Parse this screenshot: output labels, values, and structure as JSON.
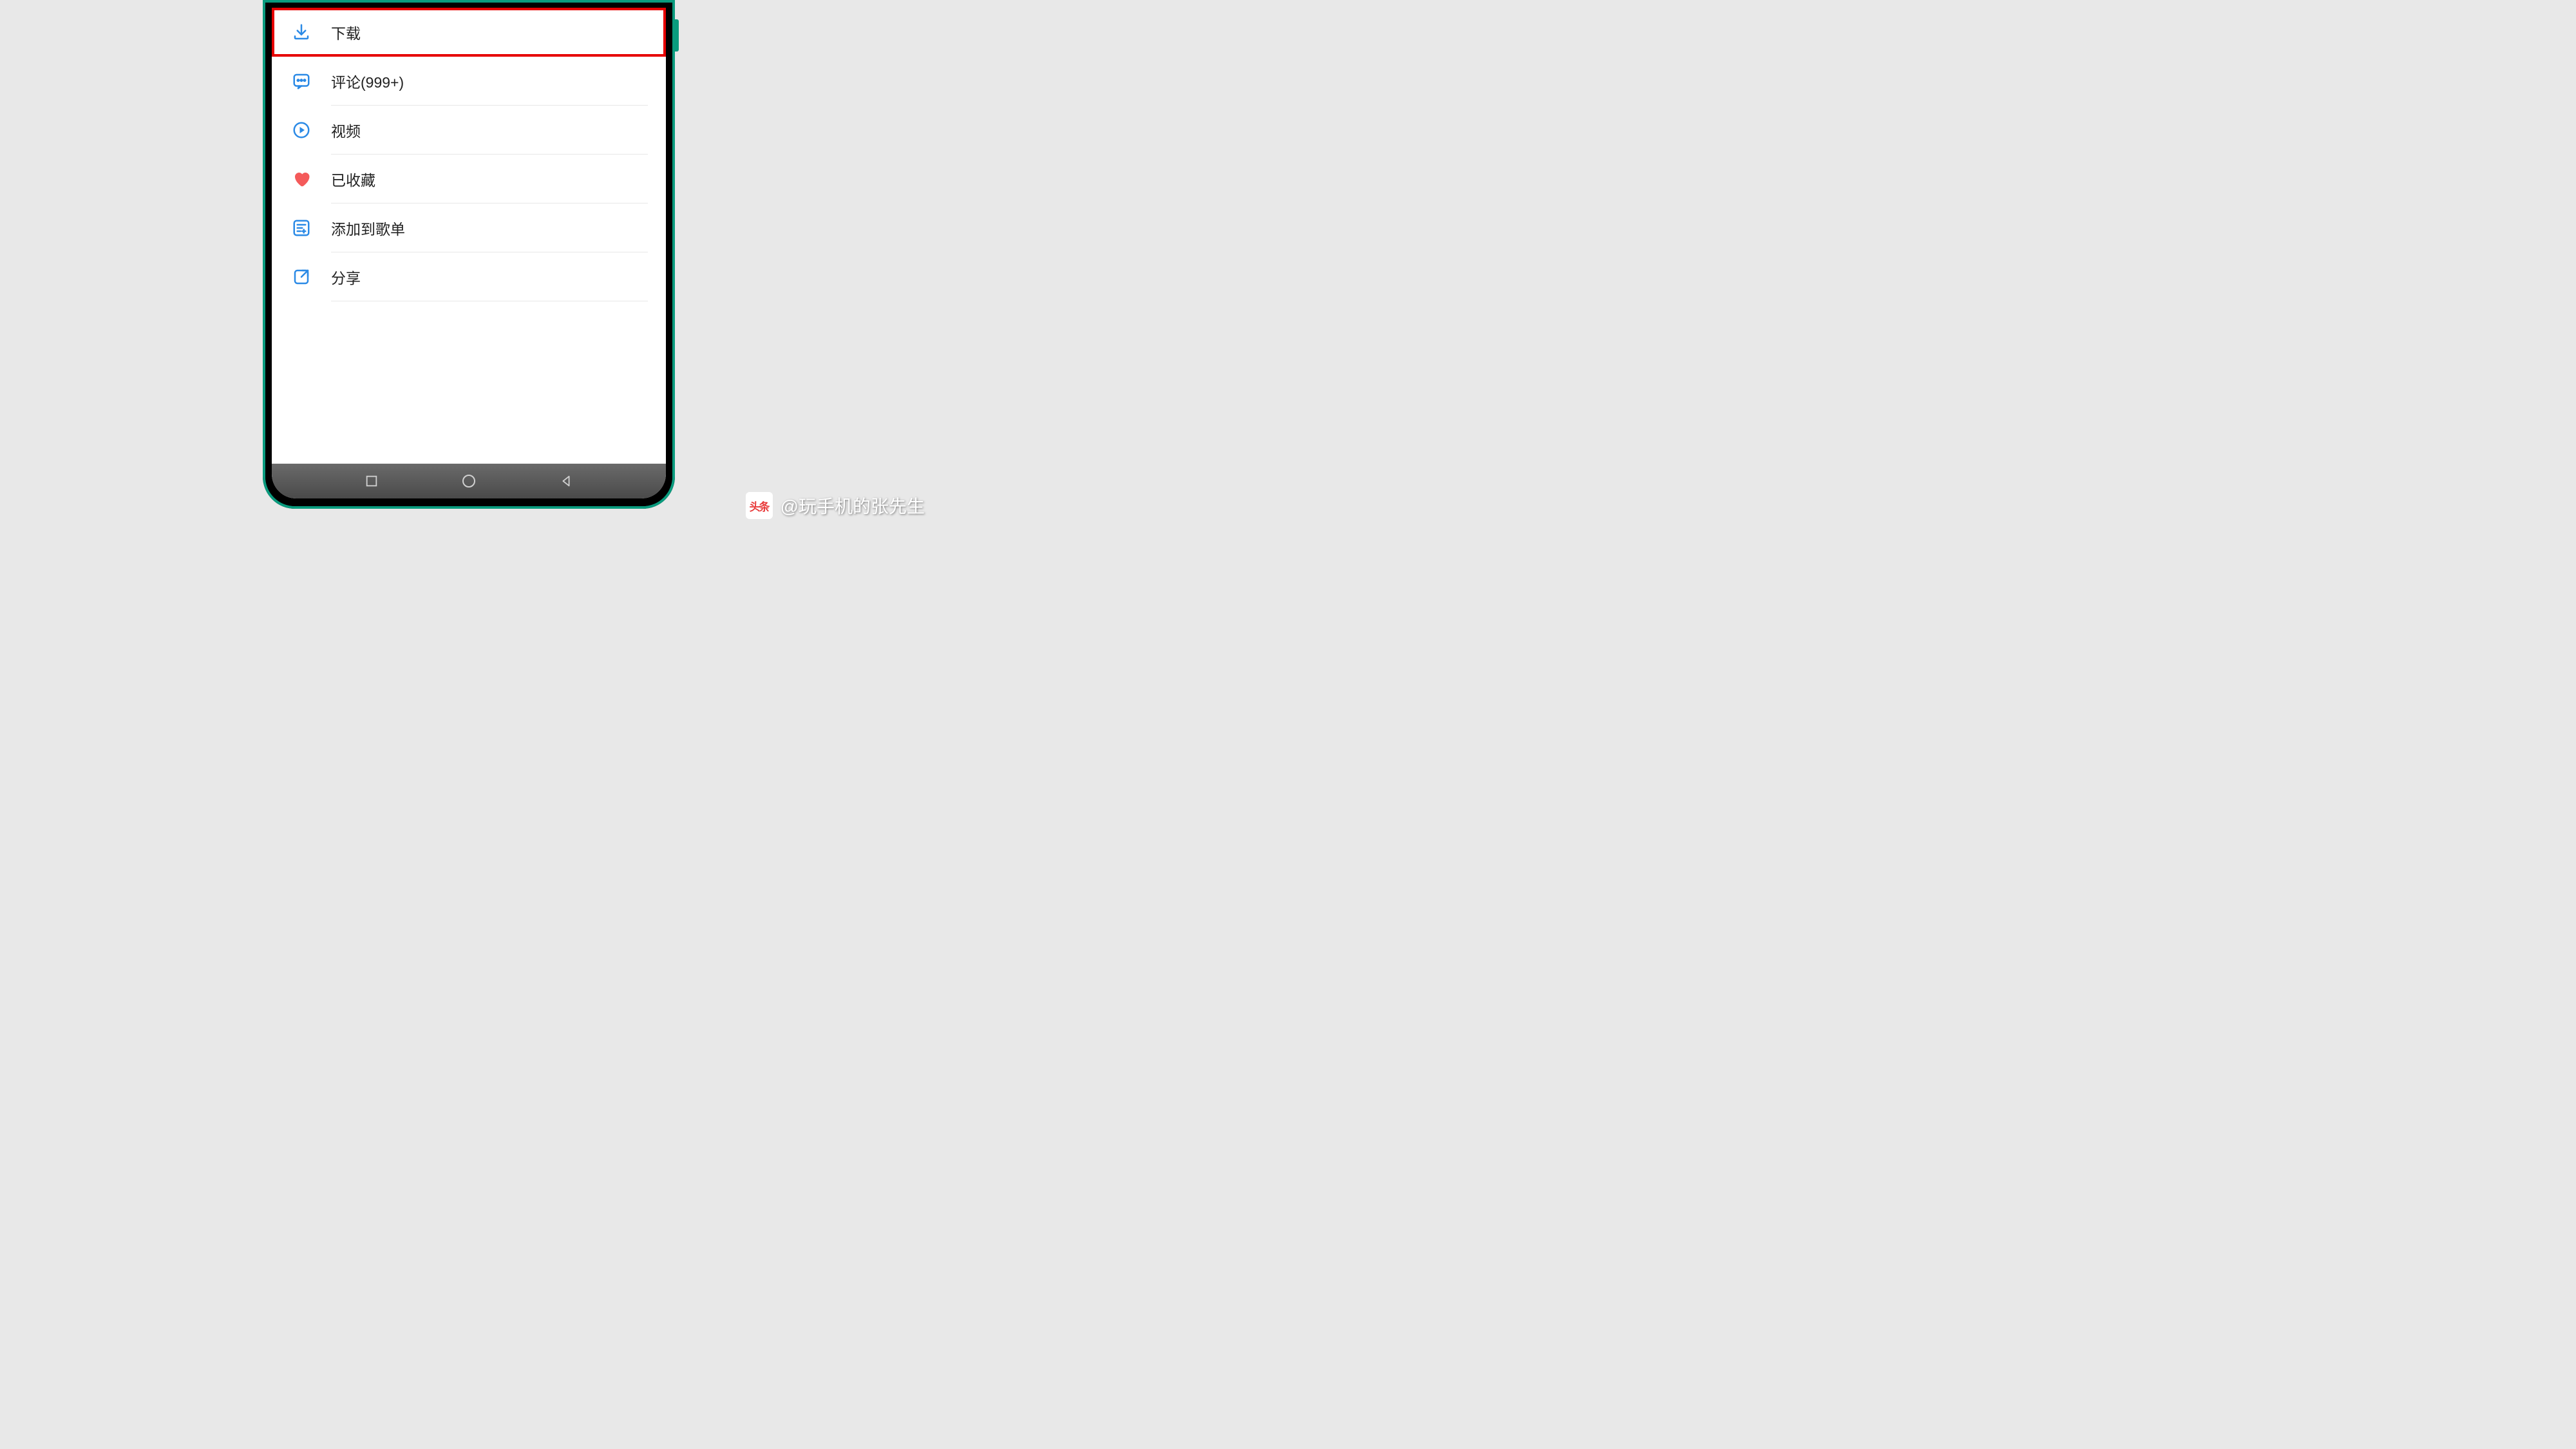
{
  "menu": {
    "download": "下载",
    "comments": "评论(999+)",
    "video": "视频",
    "favorited": "已收藏",
    "addToPlaylist": "添加到歌单",
    "share": "分享"
  },
  "watermark": {
    "logo": "头条",
    "text": "@玩手机的张先生"
  }
}
